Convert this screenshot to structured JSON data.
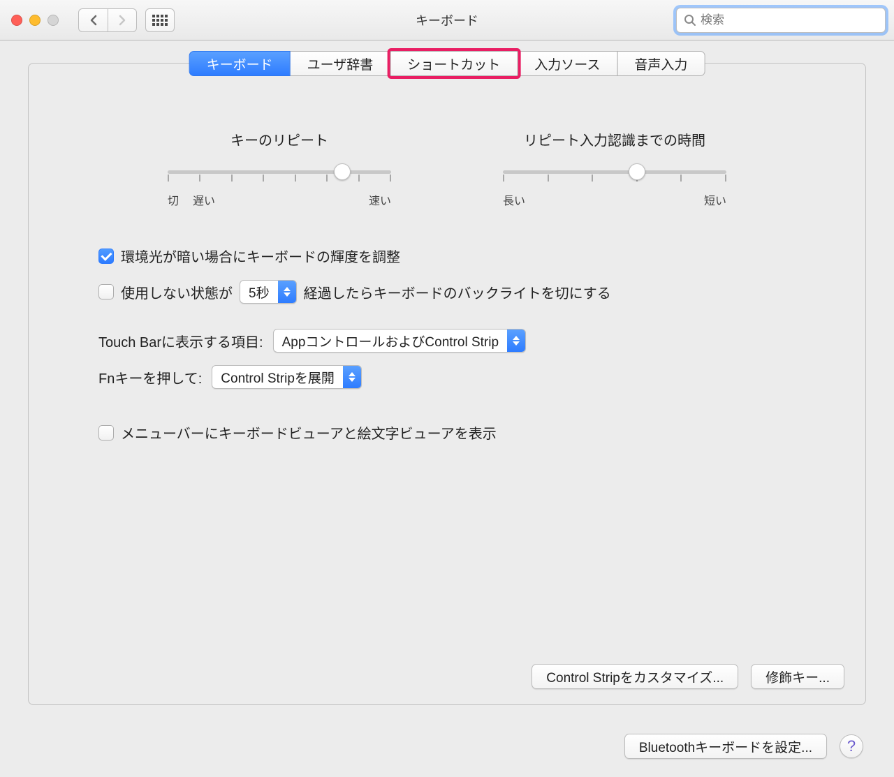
{
  "window": {
    "title": "キーボード",
    "search_placeholder": "検索"
  },
  "tabs": {
    "t1": "キーボード",
    "t2": "ユーザ辞書",
    "t3": "ショートカット",
    "t4": "入力ソース",
    "t5": "音声入力",
    "active": "キーボード",
    "highlighted": "ショートカット"
  },
  "sliders": {
    "repeat": {
      "title": "キーのリピート",
      "label_off": "切",
      "label_slow": "遅い",
      "label_fast": "速い",
      "ticks": 8,
      "value_pct": 78
    },
    "delay": {
      "title": "リピート入力認識までの時間",
      "label_long": "長い",
      "label_short": "短い",
      "ticks": 6,
      "value_pct": 60
    }
  },
  "options": {
    "dim_backlight": {
      "checked": true,
      "label": "環境光が暗い場合にキーボードの輝度を調整"
    },
    "idle_off": {
      "checked": false,
      "label_before": "使用しない状態が",
      "select_value": "5秒",
      "label_after": "経過したらキーボードのバックライトを切にする"
    },
    "touchbar": {
      "label": "Touch Barに表示する項目:",
      "value": "AppコントロールおよびControl Strip"
    },
    "fnkey": {
      "label": "Fnキーを押して:",
      "value": "Control Stripを展開"
    },
    "menu_viewer": {
      "checked": false,
      "label": "メニューバーにキーボードビューアと絵文字ビューアを表示"
    }
  },
  "buttons": {
    "customize_strip": "Control Stripをカスタマイズ...",
    "modifier_keys": "修飾キー...",
    "bluetooth": "Bluetoothキーボードを設定..."
  }
}
